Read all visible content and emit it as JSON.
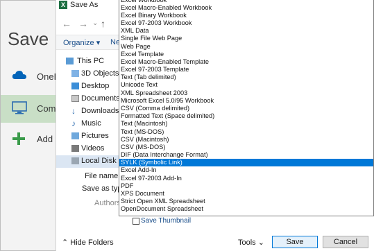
{
  "backstage": {
    "title": "Save",
    "items": [
      {
        "label": "OneD",
        "icon": "cloud-icon"
      },
      {
        "label": "Comp",
        "icon": "computer-icon"
      },
      {
        "label": "Add a",
        "icon": "plus-icon"
      }
    ]
  },
  "dialog": {
    "title": "Save As",
    "organize_label": "Organize ▾",
    "new_label": "Ne",
    "nav_items": [
      {
        "label": "This PC",
        "icon": "pc-icon"
      },
      {
        "label": "3D Objects",
        "icon": "3d-objects-icon"
      },
      {
        "label": "Desktop",
        "icon": "desktop-icon"
      },
      {
        "label": "Documents",
        "icon": "documents-icon"
      },
      {
        "label": "Downloads",
        "icon": "downloads-icon"
      },
      {
        "label": "Music",
        "icon": "music-icon"
      },
      {
        "label": "Pictures",
        "icon": "pictures-icon"
      },
      {
        "label": "Videos",
        "icon": "videos-icon"
      },
      {
        "label": "Local Disk (C:",
        "icon": "disk-icon"
      }
    ],
    "file_name_label": "File name:",
    "save_as_type_label": "Save as type:",
    "authors_label": "Authors:",
    "save_thumbnail_label": "Save Thumbnail",
    "hide_folders_label": "Hide Folders",
    "tools_label": "Tools",
    "save_label": "Save",
    "cancel_label": "Cancel"
  },
  "file_types": [
    "Excel Workbook",
    "Excel Macro-Enabled Workbook",
    "Excel Binary Workbook",
    "Excel 97-2003 Workbook",
    "XML Data",
    "Single File Web Page",
    "Web Page",
    "Excel Template",
    "Excel Macro-Enabled Template",
    "Excel 97-2003 Template",
    "Text (Tab delimited)",
    "Unicode Text",
    "XML Spreadsheet 2003",
    "Microsoft Excel 5.0/95 Workbook",
    "CSV (Comma delimited)",
    "Formatted Text (Space delimited)",
    "Text (Macintosh)",
    "Text (MS-DOS)",
    "CSV (Macintosh)",
    "CSV (MS-DOS)",
    "DIF (Data Interchange Format)",
    "SYLK (Symbolic Link)",
    "Excel Add-In",
    "Excel 97-2003 Add-In",
    "PDF",
    "XPS Document",
    "Strict Open XML Spreadsheet",
    "OpenDocument Spreadsheet"
  ],
  "selected_file_type_index": 21,
  "colors": {
    "accent": "#0078d7",
    "excel_green": "#1d6f42",
    "backstage_selected": "#c9dfc6"
  }
}
